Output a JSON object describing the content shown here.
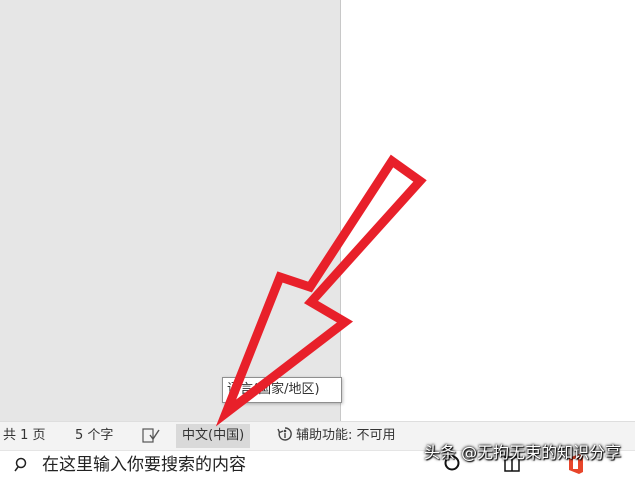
{
  "tooltip": {
    "text": "语言(国家/地区)"
  },
  "status_bar": {
    "pages": "共 1 页",
    "words": "5 个字",
    "proof_icon": "proofing-icon",
    "language": "中文(中国)",
    "accessibility": "辅助功能: 不可用"
  },
  "taskbar": {
    "search_placeholder": "在这里输入你要搜索的内容",
    "icons": [
      "search-icon",
      "task-view-icon",
      "office-icon"
    ]
  },
  "watermark": "头条 @无拘无束的知识分享",
  "colors": {
    "arrow": "#e8202a",
    "status_bg": "#f3f3f3",
    "gray_area": "#e6e6e6"
  }
}
